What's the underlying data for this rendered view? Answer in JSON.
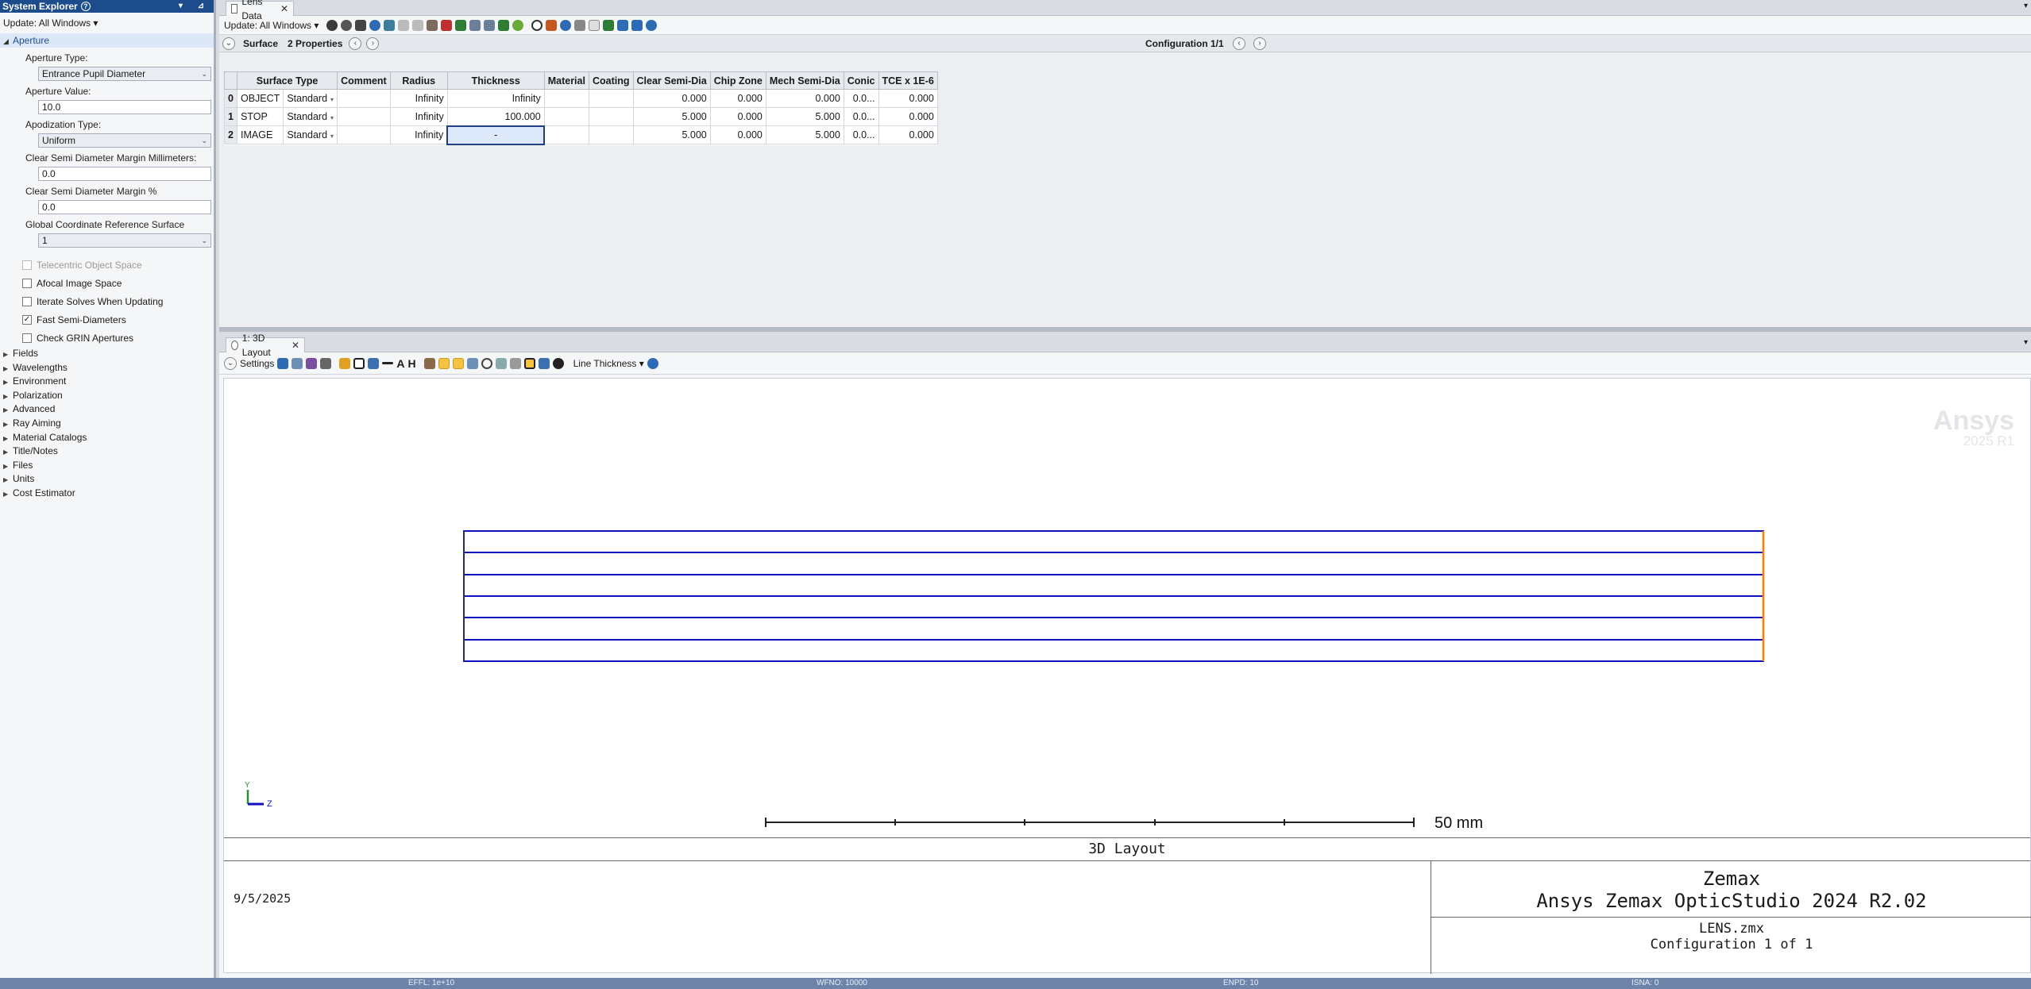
{
  "system_explorer": {
    "title": "System Explorer",
    "update_label": "Update: All Windows ▾",
    "aperture_section": "Aperture",
    "aperture_type_label": "Aperture Type:",
    "aperture_type_value": "Entrance Pupil Diameter",
    "aperture_value_label": "Aperture Value:",
    "aperture_value": "10.0",
    "apodization_label": "Apodization Type:",
    "apodization_value": "Uniform",
    "clear_margin_mm_label": "Clear Semi Diameter Margin Millimeters:",
    "clear_margin_mm_value": "0.0",
    "clear_margin_pct_label": "Clear Semi Diameter Margin %",
    "clear_margin_pct_value": "0.0",
    "gcrs_label": "Global Coordinate Reference Surface",
    "gcrs_value": "1",
    "checkboxes": [
      {
        "label": "Telecentric Object Space",
        "checked": false,
        "disabled": true
      },
      {
        "label": "Afocal Image Space",
        "checked": false,
        "disabled": false
      },
      {
        "label": "Iterate Solves When Updating",
        "checked": false,
        "disabled": false
      },
      {
        "label": "Fast Semi-Diameters",
        "checked": true,
        "disabled": false
      },
      {
        "label": "Check GRIN Apertures",
        "checked": false,
        "disabled": false
      }
    ],
    "tree_items": [
      "Fields",
      "Wavelengths",
      "Environment",
      "Polarization",
      "Advanced",
      "Ray Aiming",
      "Material Catalogs",
      "Title/Notes",
      "Files",
      "Units",
      "Cost Estimator"
    ]
  },
  "lens_data": {
    "tab_label": "Lens Data",
    "update_label": "Update: All Windows ▾",
    "surface_label": "Surface",
    "properties_label": "2 Properties",
    "configuration_label": "Configuration 1/1",
    "headers": [
      "Surface Type",
      "Comment",
      "Radius",
      "Thickness",
      "Material",
      "Coating",
      "Clear Semi-Dia",
      "Chip Zone",
      "Mech Semi-Dia",
      "Conic",
      "TCE x 1E-6"
    ],
    "rows": [
      {
        "num": "0",
        "name": "OBJECT",
        "type": "Standard",
        "comment": "",
        "radius": "Infinity",
        "thickness": "Infinity",
        "material": "",
        "coating": "",
        "clear": "0.000",
        "chip": "0.000",
        "mech": "0.000",
        "conic": "0.0...",
        "tce": "0.000"
      },
      {
        "num": "1",
        "name": "STOP",
        "type": "Standard",
        "comment": "",
        "radius": "Infinity",
        "thickness": "100.000",
        "material": "",
        "coating": "",
        "clear": "5.000",
        "chip": "0.000",
        "mech": "5.000",
        "conic": "0.0...",
        "tce": "0.000"
      },
      {
        "num": "2",
        "name": "IMAGE",
        "type": "Standard",
        "comment": "",
        "radius": "Infinity",
        "thickness": "-",
        "material": "",
        "coating": "",
        "clear": "5.000",
        "chip": "0.000",
        "mech": "5.000",
        "conic": "0.0...",
        "tce": "0.000"
      }
    ]
  },
  "layout": {
    "tab_label": "1: 3D Layout",
    "settings_label": "Settings",
    "line_thickness_label": "Line Thickness ▾",
    "watermark_brand": "Ansys",
    "watermark_version": "2025 R1",
    "axis_y": "Y",
    "axis_z": "Z",
    "scale_label": "50 mm",
    "plot_title": "3D Layout",
    "date": "9/5/2025",
    "company": "Zemax",
    "product": "Ansys Zemax OpticStudio 2024 R2.02",
    "file": "LENS.zmx",
    "config": "Configuration 1 of 1"
  },
  "status_bar": {
    "effl": "EFFL: 1e+10",
    "wfno": "WFNO: 10000",
    "enpd": "ENPD: 10",
    "isna": "ISNA: 0"
  },
  "colors": {
    "title_bar": "#1d4c8c",
    "ray": "#1010c0",
    "image_surface": "#ff8000",
    "status_bar": "#6d84a8"
  }
}
